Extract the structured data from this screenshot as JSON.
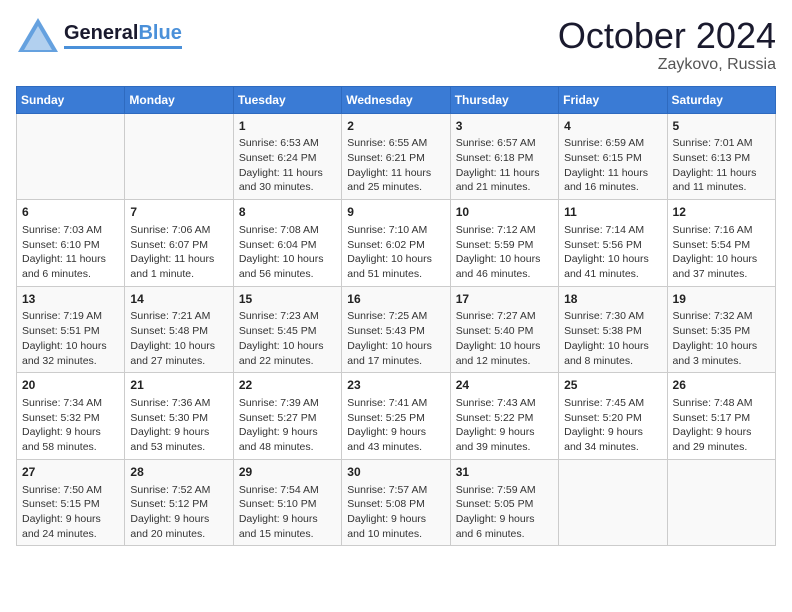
{
  "header": {
    "logo_line1": "General",
    "logo_line2": "Blue",
    "month": "October 2024",
    "location": "Zaykovo, Russia"
  },
  "weekdays": [
    "Sunday",
    "Monday",
    "Tuesday",
    "Wednesday",
    "Thursday",
    "Friday",
    "Saturday"
  ],
  "weeks": [
    [
      {
        "day": "",
        "sunrise": "",
        "sunset": "",
        "daylight": ""
      },
      {
        "day": "",
        "sunrise": "",
        "sunset": "",
        "daylight": ""
      },
      {
        "day": "1",
        "sunrise": "Sunrise: 6:53 AM",
        "sunset": "Sunset: 6:24 PM",
        "daylight": "Daylight: 11 hours and 30 minutes."
      },
      {
        "day": "2",
        "sunrise": "Sunrise: 6:55 AM",
        "sunset": "Sunset: 6:21 PM",
        "daylight": "Daylight: 11 hours and 25 minutes."
      },
      {
        "day": "3",
        "sunrise": "Sunrise: 6:57 AM",
        "sunset": "Sunset: 6:18 PM",
        "daylight": "Daylight: 11 hours and 21 minutes."
      },
      {
        "day": "4",
        "sunrise": "Sunrise: 6:59 AM",
        "sunset": "Sunset: 6:15 PM",
        "daylight": "Daylight: 11 hours and 16 minutes."
      },
      {
        "day": "5",
        "sunrise": "Sunrise: 7:01 AM",
        "sunset": "Sunset: 6:13 PM",
        "daylight": "Daylight: 11 hours and 11 minutes."
      }
    ],
    [
      {
        "day": "6",
        "sunrise": "Sunrise: 7:03 AM",
        "sunset": "Sunset: 6:10 PM",
        "daylight": "Daylight: 11 hours and 6 minutes."
      },
      {
        "day": "7",
        "sunrise": "Sunrise: 7:06 AM",
        "sunset": "Sunset: 6:07 PM",
        "daylight": "Daylight: 11 hours and 1 minute."
      },
      {
        "day": "8",
        "sunrise": "Sunrise: 7:08 AM",
        "sunset": "Sunset: 6:04 PM",
        "daylight": "Daylight: 10 hours and 56 minutes."
      },
      {
        "day": "9",
        "sunrise": "Sunrise: 7:10 AM",
        "sunset": "Sunset: 6:02 PM",
        "daylight": "Daylight: 10 hours and 51 minutes."
      },
      {
        "day": "10",
        "sunrise": "Sunrise: 7:12 AM",
        "sunset": "Sunset: 5:59 PM",
        "daylight": "Daylight: 10 hours and 46 minutes."
      },
      {
        "day": "11",
        "sunrise": "Sunrise: 7:14 AM",
        "sunset": "Sunset: 5:56 PM",
        "daylight": "Daylight: 10 hours and 41 minutes."
      },
      {
        "day": "12",
        "sunrise": "Sunrise: 7:16 AM",
        "sunset": "Sunset: 5:54 PM",
        "daylight": "Daylight: 10 hours and 37 minutes."
      }
    ],
    [
      {
        "day": "13",
        "sunrise": "Sunrise: 7:19 AM",
        "sunset": "Sunset: 5:51 PM",
        "daylight": "Daylight: 10 hours and 32 minutes."
      },
      {
        "day": "14",
        "sunrise": "Sunrise: 7:21 AM",
        "sunset": "Sunset: 5:48 PM",
        "daylight": "Daylight: 10 hours and 27 minutes."
      },
      {
        "day": "15",
        "sunrise": "Sunrise: 7:23 AM",
        "sunset": "Sunset: 5:45 PM",
        "daylight": "Daylight: 10 hours and 22 minutes."
      },
      {
        "day": "16",
        "sunrise": "Sunrise: 7:25 AM",
        "sunset": "Sunset: 5:43 PM",
        "daylight": "Daylight: 10 hours and 17 minutes."
      },
      {
        "day": "17",
        "sunrise": "Sunrise: 7:27 AM",
        "sunset": "Sunset: 5:40 PM",
        "daylight": "Daylight: 10 hours and 12 minutes."
      },
      {
        "day": "18",
        "sunrise": "Sunrise: 7:30 AM",
        "sunset": "Sunset: 5:38 PM",
        "daylight": "Daylight: 10 hours and 8 minutes."
      },
      {
        "day": "19",
        "sunrise": "Sunrise: 7:32 AM",
        "sunset": "Sunset: 5:35 PM",
        "daylight": "Daylight: 10 hours and 3 minutes."
      }
    ],
    [
      {
        "day": "20",
        "sunrise": "Sunrise: 7:34 AM",
        "sunset": "Sunset: 5:32 PM",
        "daylight": "Daylight: 9 hours and 58 minutes."
      },
      {
        "day": "21",
        "sunrise": "Sunrise: 7:36 AM",
        "sunset": "Sunset: 5:30 PM",
        "daylight": "Daylight: 9 hours and 53 minutes."
      },
      {
        "day": "22",
        "sunrise": "Sunrise: 7:39 AM",
        "sunset": "Sunset: 5:27 PM",
        "daylight": "Daylight: 9 hours and 48 minutes."
      },
      {
        "day": "23",
        "sunrise": "Sunrise: 7:41 AM",
        "sunset": "Sunset: 5:25 PM",
        "daylight": "Daylight: 9 hours and 43 minutes."
      },
      {
        "day": "24",
        "sunrise": "Sunrise: 7:43 AM",
        "sunset": "Sunset: 5:22 PM",
        "daylight": "Daylight: 9 hours and 39 minutes."
      },
      {
        "day": "25",
        "sunrise": "Sunrise: 7:45 AM",
        "sunset": "Sunset: 5:20 PM",
        "daylight": "Daylight: 9 hours and 34 minutes."
      },
      {
        "day": "26",
        "sunrise": "Sunrise: 7:48 AM",
        "sunset": "Sunset: 5:17 PM",
        "daylight": "Daylight: 9 hours and 29 minutes."
      }
    ],
    [
      {
        "day": "27",
        "sunrise": "Sunrise: 7:50 AM",
        "sunset": "Sunset: 5:15 PM",
        "daylight": "Daylight: 9 hours and 24 minutes."
      },
      {
        "day": "28",
        "sunrise": "Sunrise: 7:52 AM",
        "sunset": "Sunset: 5:12 PM",
        "daylight": "Daylight: 9 hours and 20 minutes."
      },
      {
        "day": "29",
        "sunrise": "Sunrise: 7:54 AM",
        "sunset": "Sunset: 5:10 PM",
        "daylight": "Daylight: 9 hours and 15 minutes."
      },
      {
        "day": "30",
        "sunrise": "Sunrise: 7:57 AM",
        "sunset": "Sunset: 5:08 PM",
        "daylight": "Daylight: 9 hours and 10 minutes."
      },
      {
        "day": "31",
        "sunrise": "Sunrise: 7:59 AM",
        "sunset": "Sunset: 5:05 PM",
        "daylight": "Daylight: 9 hours and 6 minutes."
      },
      {
        "day": "",
        "sunrise": "",
        "sunset": "",
        "daylight": ""
      },
      {
        "day": "",
        "sunrise": "",
        "sunset": "",
        "daylight": ""
      }
    ]
  ]
}
